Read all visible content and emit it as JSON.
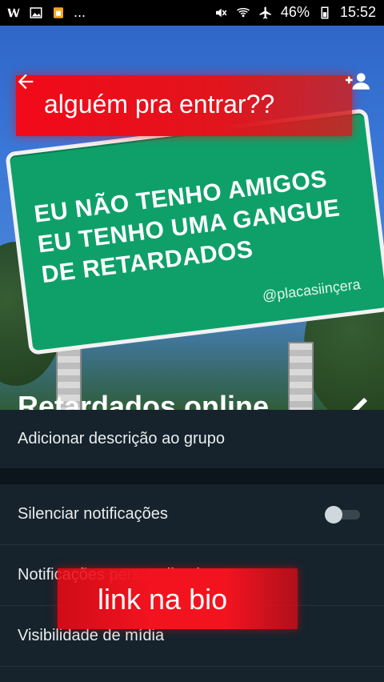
{
  "status_bar": {
    "battery": "46%",
    "time": "15:52",
    "dots": "...",
    "left_icons": [
      "w-app-icon",
      "gallery-icon",
      "sim-icon"
    ],
    "right_icons": [
      "mute-icon",
      "wifi-icon",
      "airplane-icon",
      "battery-icon"
    ]
  },
  "header": {
    "back_icon": "arrow-left-icon",
    "add_participant_icon": "add-user-icon",
    "group_name": "Retardados online",
    "edit_icon": "pencil-icon"
  },
  "image": {
    "banner_text": "alguém pra entrar??",
    "sign_lines": [
      "EU NÃO TENHO AMIGOS",
      "EU TENHO UMA GANGUE",
      "DE RETARDADOS"
    ],
    "sign_handle": "@placasiinçera"
  },
  "description": {
    "label": "Adicionar descrição ao grupo"
  },
  "settings": {
    "mute_label": "Silenciar notificações",
    "mute_enabled": false,
    "custom_notifications_label": "Notificações personalizadas",
    "media_visibility_label": "Visibilidade de mídia"
  },
  "overlay": {
    "link_text": "link na bio"
  },
  "colors": {
    "background": "#0f1d26",
    "panel": "#16232c",
    "sign_green": "#0fa06a",
    "banner_red": "#f3131f"
  }
}
